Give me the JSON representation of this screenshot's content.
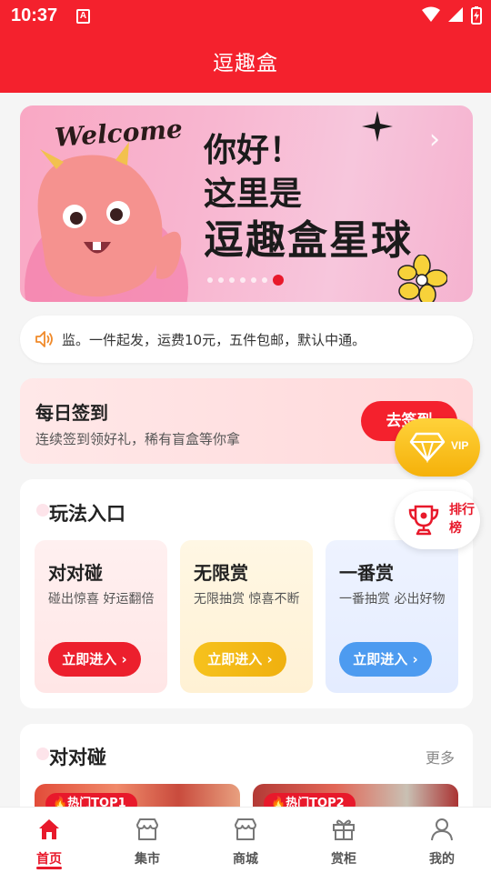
{
  "status_bar": {
    "time": "10:37",
    "notification_icon": "A"
  },
  "header": {
    "title": "逗趣盒"
  },
  "banner": {
    "welcome": "Welcome",
    "line1": "你好！",
    "line2": "这里是",
    "line3": "逗趣盒星球",
    "active_slide": 6
  },
  "notice": {
    "text": "监。一件起发，运费10元，五件包邮，默认中通。"
  },
  "signin": {
    "title": "每日签到",
    "subtitle": "连续签到领好礼，稀有盲盒等你拿",
    "button": "去签到"
  },
  "play": {
    "title": "玩法入口",
    "tiles": [
      {
        "title": "对对碰",
        "desc": "碰出惊喜 好运翻倍",
        "button": "立即进入 ›"
      },
      {
        "title": "无限赏",
        "desc": "无限抽赏 惊喜不断",
        "button": "立即进入 ›"
      },
      {
        "title": "一番赏",
        "desc": "一番抽赏 必出好物",
        "button": "立即进入 ›"
      }
    ]
  },
  "duiduipeng": {
    "title": "对对碰",
    "more": "更多",
    "cards": [
      {
        "badge": "🔥热门TOP1"
      },
      {
        "badge": "🔥热门TOP2"
      }
    ]
  },
  "float": {
    "vip": "VIP",
    "rank": "排行榜"
  },
  "nav": {
    "items": [
      {
        "label": "首页",
        "icon": "home-icon"
      },
      {
        "label": "集市",
        "icon": "market-icon"
      },
      {
        "label": "商城",
        "icon": "shop-icon"
      },
      {
        "label": "赏柜",
        "icon": "gift-icon"
      },
      {
        "label": "我的",
        "icon": "user-icon"
      }
    ]
  },
  "colors": {
    "brand": "#f4212d",
    "vip": "#f5b10a",
    "blue": "#4d9bf0"
  }
}
